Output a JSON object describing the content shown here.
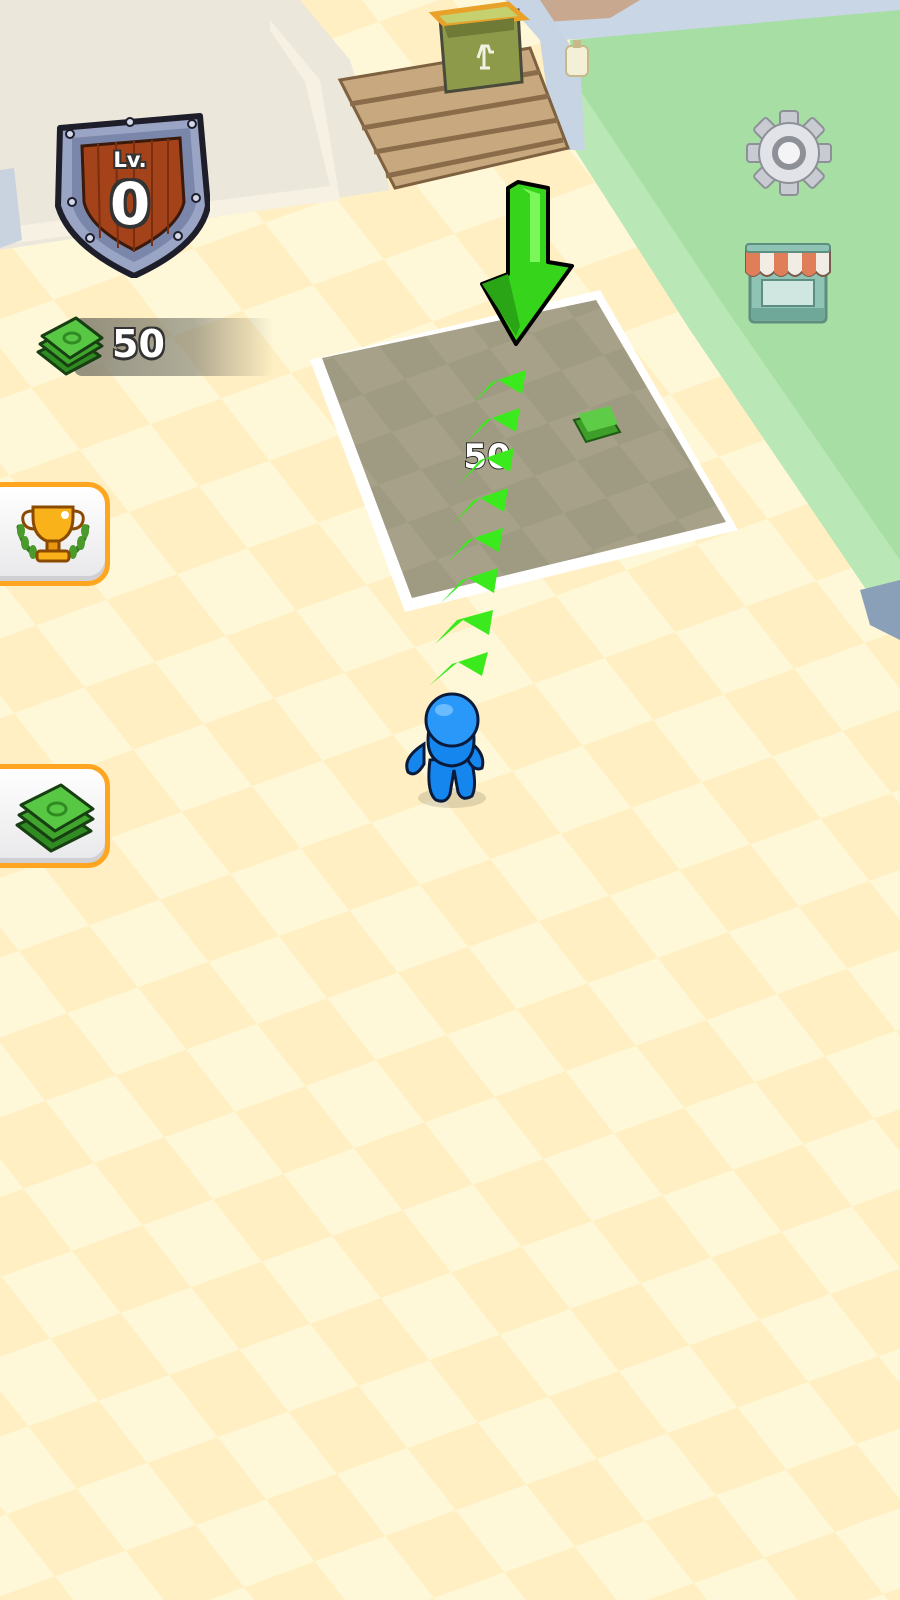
{
  "hud": {
    "level_prefix": "Lv.",
    "level_value": "0",
    "cash_value": "50"
  },
  "build_zone": {
    "cost_label": "50"
  },
  "icons": {
    "level": "level-shield-icon",
    "cash": "cash-stack-icon",
    "settings": "gear-icon",
    "shop": "shop-stall-icon",
    "trophy": "trophy-icon",
    "money": "cash-stack-icon",
    "trash": "trash-can-icon",
    "pointer": "down-arrow-icon"
  },
  "colors": {
    "floor_light": "#fff8d8",
    "floor_dark": "#fff0c4",
    "grass": "#a6deA3",
    "player": "#1a8cf5",
    "guide_arrow": "#44e824",
    "button_border": "#ffa51f",
    "build_zone": "#a8a28a"
  }
}
